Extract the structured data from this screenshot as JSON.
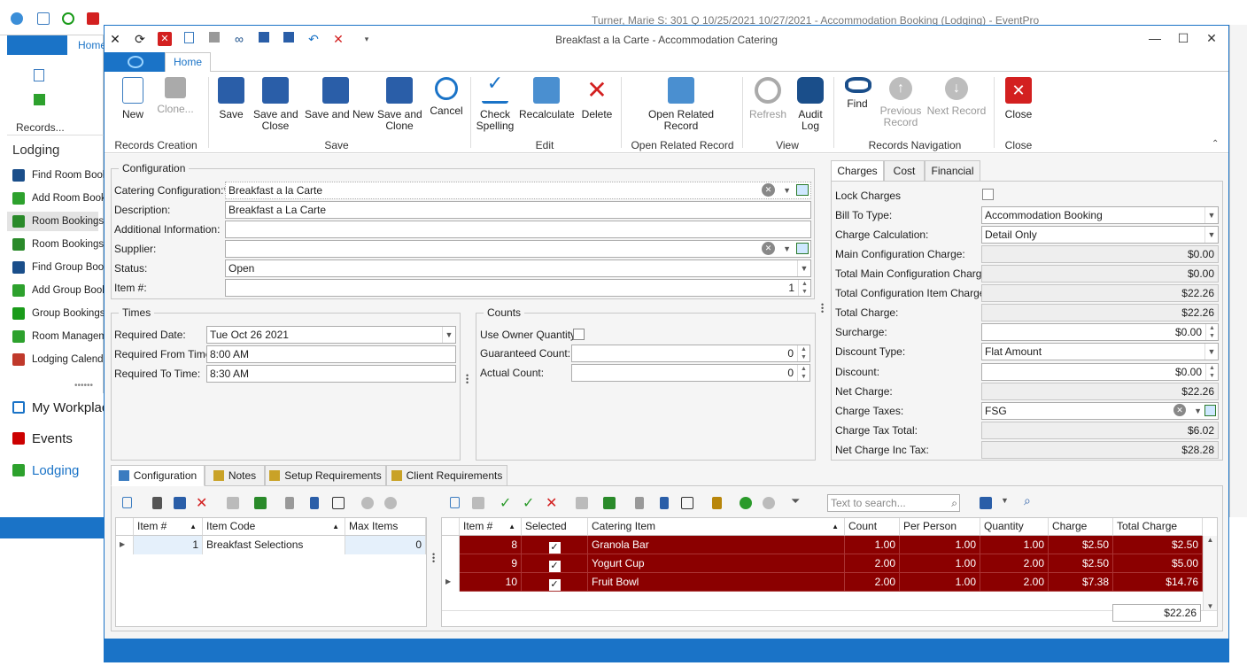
{
  "background_app": {
    "title": "Turner, Marie S: 301 Q 10/25/2021 10/27/2021 - Accommodation Booking (Lodging) - EventPro",
    "home_tab": "Home",
    "records_group": "Records...",
    "section_title": "Lodging",
    "nav_items": [
      "Find Room Booking",
      "Add Room Booking",
      "Room Bookings",
      "Room Bookings b",
      "Find Group Booki",
      "Add Group Booki",
      "Group Bookings",
      "Room Manageme",
      "Lodging Calenda"
    ],
    "big_nav": [
      "My Workplac",
      "Events",
      "Lodging"
    ]
  },
  "window": {
    "title": "Breakfast a la Carte - Accommodation Catering",
    "home_tab": "Home"
  },
  "ribbon": {
    "buttons": [
      {
        "label": "New",
        "icon": "new-document-icon"
      },
      {
        "label": "Clone...",
        "icon": "clone-icon",
        "disabled": true
      },
      {
        "label": "Save",
        "icon": "save-icon"
      },
      {
        "label": "Save and\nClose",
        "icon": "save-close-icon"
      },
      {
        "label": "Save and New",
        "icon": "save-new-icon"
      },
      {
        "label": "Save and\nClone",
        "icon": "save-clone-icon"
      },
      {
        "label": "Cancel",
        "icon": "undo-icon"
      },
      {
        "label": "Check\nSpelling",
        "icon": "spellcheck-icon"
      },
      {
        "label": "Recalculate",
        "icon": "calculator-icon"
      },
      {
        "label": "Delete",
        "icon": "delete-x-icon"
      },
      {
        "label": "Open Related\nRecord",
        "icon": "open-related-icon"
      },
      {
        "label": "Refresh",
        "icon": "refresh-icon",
        "disabled": true
      },
      {
        "label": "Audit\nLog",
        "icon": "audit-log-icon"
      },
      {
        "label": "Find",
        "icon": "binoculars-icon"
      },
      {
        "label": "Previous\nRecord",
        "icon": "up-arrow-icon",
        "disabled": true
      },
      {
        "label": "Next Record",
        "icon": "down-arrow-icon",
        "disabled": true
      },
      {
        "label": "Close",
        "icon": "close-red-icon"
      }
    ],
    "groups": [
      "Records Creation",
      "Save",
      "Edit",
      "Open Related Record",
      "View",
      "Records Navigation",
      "Close"
    ]
  },
  "configuration": {
    "legend": "Configuration",
    "catering_configuration_label": "Catering Configuration:*",
    "catering_configuration": "Breakfast a la Carte",
    "description_label": "Description:",
    "description": "Breakfast a La Carte",
    "additional_info_label": "Additional Information:",
    "additional_info": "",
    "supplier_label": "Supplier:",
    "supplier": "",
    "status_label": "Status:",
    "status": "Open",
    "item_no_label": "Item #:",
    "item_no": "1"
  },
  "times": {
    "legend": "Times",
    "required_date_label": "Required Date:",
    "required_date": "Tue Oct 26 2021",
    "from_label": "Required From Time:",
    "from": "8:00 AM",
    "to_label": "Required To Time:",
    "to": "8:30 AM"
  },
  "counts": {
    "legend": "Counts",
    "use_owner_label": "Use Owner Quantity",
    "guaranteed_label": "Guaranteed Count:",
    "guaranteed": "0",
    "actual_label": "Actual Count:",
    "actual": "0"
  },
  "charges": {
    "tabs": [
      "Charges",
      "Cost",
      "Financial"
    ],
    "lock_label": "Lock Charges",
    "bill_to_label": "Bill To Type:",
    "bill_to": "Accommodation Booking",
    "calc_label": "Charge Calculation:",
    "calc": "Detail Only",
    "main_config_label": "Main Configuration Charge:",
    "main_config": "$0.00",
    "total_main_label": "Total Main Configuration Charge:",
    "total_main": "$0.00",
    "total_item_label": "Total Configuration Item Charge:",
    "total_item": "$22.26",
    "total_charge_label": "Total Charge:",
    "total_charge": "$22.26",
    "surcharge_label": "Surcharge:",
    "surcharge": "$0.00",
    "discount_type_label": "Discount Type:",
    "discount_type": "Flat Amount",
    "discount_label": "Discount:",
    "discount": "$0.00",
    "net_label": "Net Charge:",
    "net": "$22.26",
    "taxes_label": "Charge Taxes:",
    "taxes": "FSG",
    "tax_total_label": "Charge Tax Total:",
    "tax_total": "$6.02",
    "net_inc_label": "Net Charge Inc Tax:",
    "net_inc": "$28.28"
  },
  "bottom_tabs": [
    "Configuration",
    "Notes",
    "Setup Requirements",
    "Client Requirements"
  ],
  "left_grid": {
    "columns": [
      "Item #",
      "Item Code",
      "Max Items"
    ],
    "rows": [
      {
        "item": "1",
        "code": "Breakfast Selections",
        "max": "0"
      }
    ]
  },
  "right_grid": {
    "search_placeholder": "Text to search...",
    "columns": [
      "Item #",
      "Selected",
      "Catering Item",
      "Count",
      "Per Person",
      "Quantity",
      "Charge",
      "Total Charge"
    ],
    "rows": [
      {
        "item": "8",
        "selected": true,
        "name": "Granola Bar",
        "count": "1.00",
        "per_person": "1.00",
        "quantity": "1.00",
        "charge": "$2.50",
        "total": "$2.50"
      },
      {
        "item": "9",
        "selected": true,
        "name": "Yogurt Cup",
        "count": "2.00",
        "per_person": "1.00",
        "quantity": "2.00",
        "charge": "$2.50",
        "total": "$5.00"
      },
      {
        "item": "10",
        "selected": true,
        "name": "Fruit Bowl",
        "count": "2.00",
        "per_person": "1.00",
        "quantity": "2.00",
        "charge": "$7.38",
        "total": "$14.76"
      }
    ],
    "footer_total": "$22.26"
  }
}
